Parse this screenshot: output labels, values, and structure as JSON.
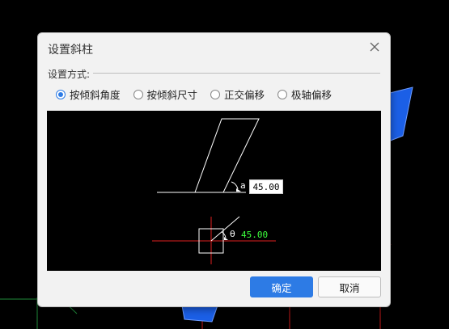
{
  "dialog": {
    "title": "设置斜柱",
    "section_label": "设置方式:",
    "options": [
      {
        "label": "按倾斜角度",
        "checked": true
      },
      {
        "label": "按倾斜尺寸",
        "checked": false
      },
      {
        "label": "正交偏移",
        "checked": false
      },
      {
        "label": "极轴偏移",
        "checked": false
      }
    ],
    "preview": {
      "angle_a_label": "a",
      "angle_a_value": "45.00",
      "angle_theta_label": "θ",
      "angle_theta_value": "45.00"
    },
    "buttons": {
      "ok": "确定",
      "cancel": "取消"
    }
  },
  "colors": {
    "accent": "#2d7be5",
    "arrow": "#e04545",
    "cad_green": "#3cff3c",
    "cad_red": "#e02020"
  },
  "icons": {
    "close": "close-icon"
  }
}
